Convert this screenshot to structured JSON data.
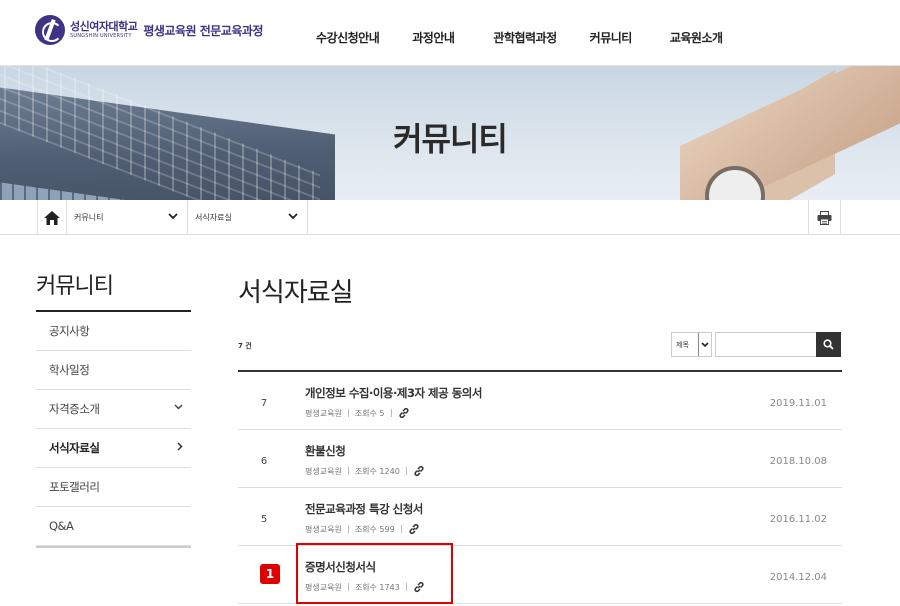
{
  "header": {
    "logo_kor": "성신여자대학교",
    "logo_eng": "SUNGSHIN UNIVERSITY",
    "logo_sub": "평생교육원 전문교육과정",
    "nav": [
      "수강신청안내",
      "과정안내",
      "관학협력과정",
      "커뮤니티",
      "교육원소개"
    ]
  },
  "banner": {
    "title": "커뮤니티"
  },
  "location": {
    "level1": "커뮤니티",
    "level2": "서식자료실"
  },
  "sidebar": {
    "title": "커뮤니티",
    "items": [
      {
        "label": "공지사항"
      },
      {
        "label": "학사일정"
      },
      {
        "label": "자격증소개"
      },
      {
        "label": "서식자료실"
      },
      {
        "label": "포토갤러리"
      },
      {
        "label": "Q&A"
      }
    ]
  },
  "main": {
    "title": "서식자료실",
    "count": "7 건",
    "search": {
      "select_value": "제목",
      "input_value": ""
    },
    "rows": [
      {
        "num": "7",
        "title": "개인정보 수집·이용·제3자 제공 동의서",
        "writer": "평생교육원",
        "views": "조회수 5",
        "date": "2019.11.01"
      },
      {
        "num": "6",
        "title": "환불신청",
        "writer": "평생교육원",
        "views": "조회수 1240",
        "date": "2018.10.08"
      },
      {
        "num": "5",
        "title": "전문교육과정 특강 신청서",
        "writer": "평생교육원",
        "views": "조회수 599",
        "date": "2016.11.02"
      },
      {
        "num": "",
        "title": "증명서신청서식",
        "writer": "평생교육원",
        "views": "조회수 1743",
        "date": "2014.12.04"
      }
    ]
  },
  "annotation": {
    "badge": "1",
    "color": "#e00000"
  },
  "colors": {
    "brand": "#3d3487",
    "dark": "#333333"
  }
}
